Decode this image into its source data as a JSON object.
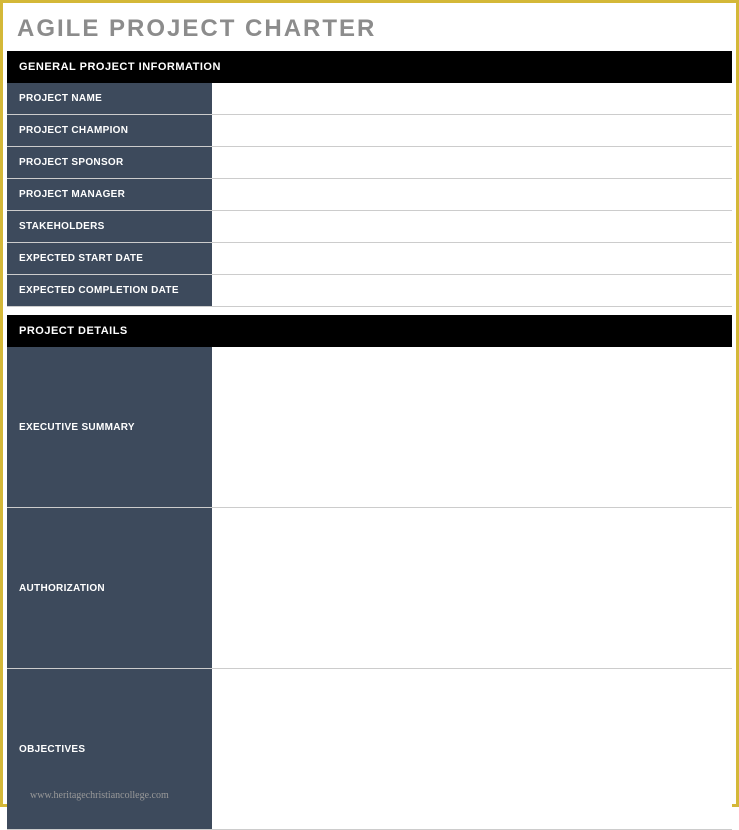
{
  "title": "AGILE PROJECT CHARTER",
  "sections": {
    "general": {
      "header": "GENERAL PROJECT INFORMATION",
      "rows": {
        "project_name": {
          "label": "PROJECT NAME",
          "value": ""
        },
        "project_champion": {
          "label": "PROJECT CHAMPION",
          "value": ""
        },
        "project_sponsor": {
          "label": "PROJECT SPONSOR",
          "value": ""
        },
        "project_manager": {
          "label": "PROJECT MANAGER",
          "value": ""
        },
        "stakeholders": {
          "label": "STAKEHOLDERS",
          "value": ""
        },
        "expected_start": {
          "label": "EXPECTED START DATE",
          "value": ""
        },
        "expected_completion": {
          "label": "EXPECTED COMPLETION DATE",
          "value": ""
        }
      }
    },
    "details": {
      "header": "PROJECT DETAILS",
      "rows": {
        "executive_summary": {
          "label": "EXECUTIVE SUMMARY",
          "value": ""
        },
        "authorization": {
          "label": "AUTHORIZATION",
          "value": ""
        },
        "objectives": {
          "label": "OBJECTIVES",
          "value": ""
        }
      }
    }
  },
  "watermark": "www.heritagechristiancollege.com"
}
